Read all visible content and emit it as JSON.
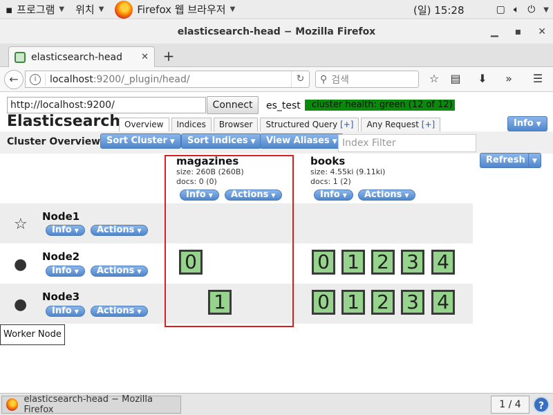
{
  "gnome_panel": {
    "programs": "프로그램",
    "places": "위치",
    "app": "Firefox 웹 브라우저",
    "clock": "(일) 15:28",
    "icons": [
      "window-icon",
      "volume-icon",
      "power-icon"
    ]
  },
  "window": {
    "title": "elasticsearch-head − Mozilla Firefox",
    "tab_title": "elasticsearch-head",
    "url_host": "localhost",
    "url_path": ":9200/_plugin/head/",
    "search_placeholder": "검색"
  },
  "es": {
    "connect_url": "http://localhost:9200/",
    "connect_label": "Connect",
    "cluster_name": "es_test",
    "health": "cluster health: green (12 of 12)",
    "health_color": "#0a8a0a",
    "title": "Elasticsearch",
    "tabs": [
      {
        "label": "Overview",
        "plus": ""
      },
      {
        "label": "Indices",
        "plus": ""
      },
      {
        "label": "Browser",
        "plus": ""
      },
      {
        "label": "Structured Query",
        "plus": "[+]"
      },
      {
        "label": "Any Request",
        "plus": "[+]"
      }
    ],
    "info_label": "Info",
    "overview_title": "Cluster Overview",
    "sort_cluster": "Sort Cluster",
    "sort_indices": "Sort Indices",
    "view_aliases": "View Aliases",
    "index_filter_placeholder": "Index Filter",
    "refresh": "Refresh",
    "actions_label": "Actions",
    "indices": [
      {
        "name": "magazines",
        "size": "size: 260B (260B)",
        "docs": "docs: 0 (0)"
      },
      {
        "name": "books",
        "size": "size: 4.55ki (9.11ki)",
        "docs": "docs: 1 (2)"
      }
    ],
    "nodes": [
      {
        "name": "Node1",
        "icon": "star-icon"
      },
      {
        "name": "Node2",
        "icon": "circle-icon"
      },
      {
        "name": "Node3",
        "icon": "circle-icon"
      }
    ],
    "shards": {
      "node2_magazines": "0",
      "node3_magazines": "1",
      "books": [
        "0",
        "1",
        "2",
        "3",
        "4"
      ]
    },
    "tooltip": "Worker Node",
    "accent_color": "#4f86cc",
    "shard_color": "#96d38c",
    "highlight_color": "#d42020"
  },
  "taskbar": {
    "window_label": "elasticsearch-head − Mozilla Firefox",
    "workspace": "1 / 4"
  }
}
